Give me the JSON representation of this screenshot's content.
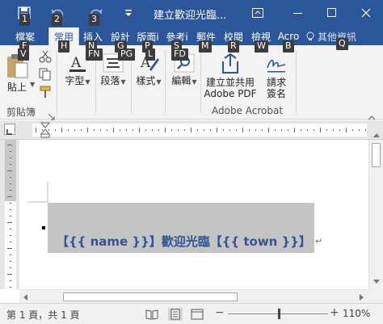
{
  "window": {
    "title": "建立歡迎光臨...",
    "accent": "#2b579a"
  },
  "quick_access": [
    {
      "icon": "save-icon",
      "keytip": "1"
    },
    {
      "icon": "undo-icon",
      "keytip": "2"
    },
    {
      "icon": "redo-icon",
      "keytip": "3"
    },
    {
      "icon": "customize-quick-access-icon",
      "keytip": ""
    }
  ],
  "tabs": [
    {
      "label": "檔案",
      "keytip": "F",
      "active": false
    },
    {
      "label": "常用",
      "keytip": "H",
      "active": true
    },
    {
      "label": "插入",
      "keytip": "N",
      "active": false
    },
    {
      "label": "設計",
      "keytip": "G",
      "active": false
    },
    {
      "label": "版面i",
      "keytip": "P",
      "active": false
    },
    {
      "label": "參考i",
      "keytip": "S",
      "active": false
    },
    {
      "label": "郵件",
      "keytip": "M",
      "active": false
    },
    {
      "label": "校閱",
      "keytip": "R",
      "active": false
    },
    {
      "label": "檢視",
      "keytip": "W",
      "active": false
    },
    {
      "label": "Acro",
      "keytip": "B",
      "active": false
    }
  ],
  "tell_me": {
    "label": "其他資訊",
    "keytip": "Q"
  },
  "ribbon": {
    "paste_label": "貼上",
    "clipboard_group": "剪貼簿",
    "font_label": "字型",
    "paragraph_label": "段落",
    "styles_label": "樣式",
    "editing_label": "編輯",
    "acrobat_create_label_1": "建立並共用",
    "acrobat_create_label_2": "Adobe PDF",
    "acrobat_sign_label_1": "請求",
    "acrobat_sign_label_2": "簽名",
    "acrobat_group": "Adobe Acrobat"
  },
  "document": {
    "line_text": "【{{ name }}】歡迎光臨【{{ town }}】",
    "para_mark": "↵",
    "text_color": "#2f5597",
    "highlight_color": "#c4c4c4"
  },
  "statusbar": {
    "page_info": "第 1 頁，共 1 頁",
    "zoom": "110%"
  }
}
